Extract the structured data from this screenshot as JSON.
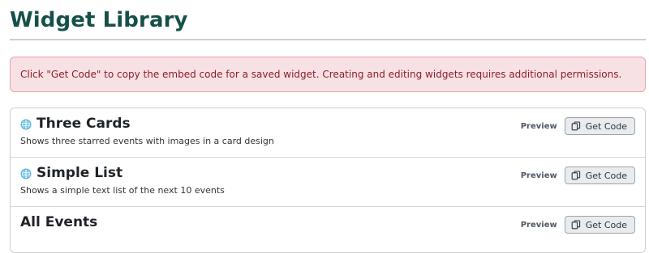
{
  "page": {
    "title": "Widget Library"
  },
  "alert": {
    "message": "Click \"Get Code\" to copy the embed code for a saved widget. Creating and editing widgets requires additional permissions."
  },
  "widgets": [
    {
      "name": "Three Cards",
      "description": "Shows three starred events with images in a card design",
      "preview_label": "Preview",
      "get_code_label": "Get Code",
      "icon": "globe-icon"
    },
    {
      "name": "Simple List",
      "description": "Shows a simple text list of the next 10 events",
      "preview_label": "Preview",
      "get_code_label": "Get Code",
      "icon": "globe-icon"
    },
    {
      "name": "All Events",
      "description": "",
      "preview_label": "Preview",
      "get_code_label": "Get Code",
      "icon": ""
    }
  ],
  "colors": {
    "title": "#15504a",
    "alert_bg": "#f8e1e4",
    "alert_text": "#8c1d2a",
    "globe": "#5db8dc"
  }
}
